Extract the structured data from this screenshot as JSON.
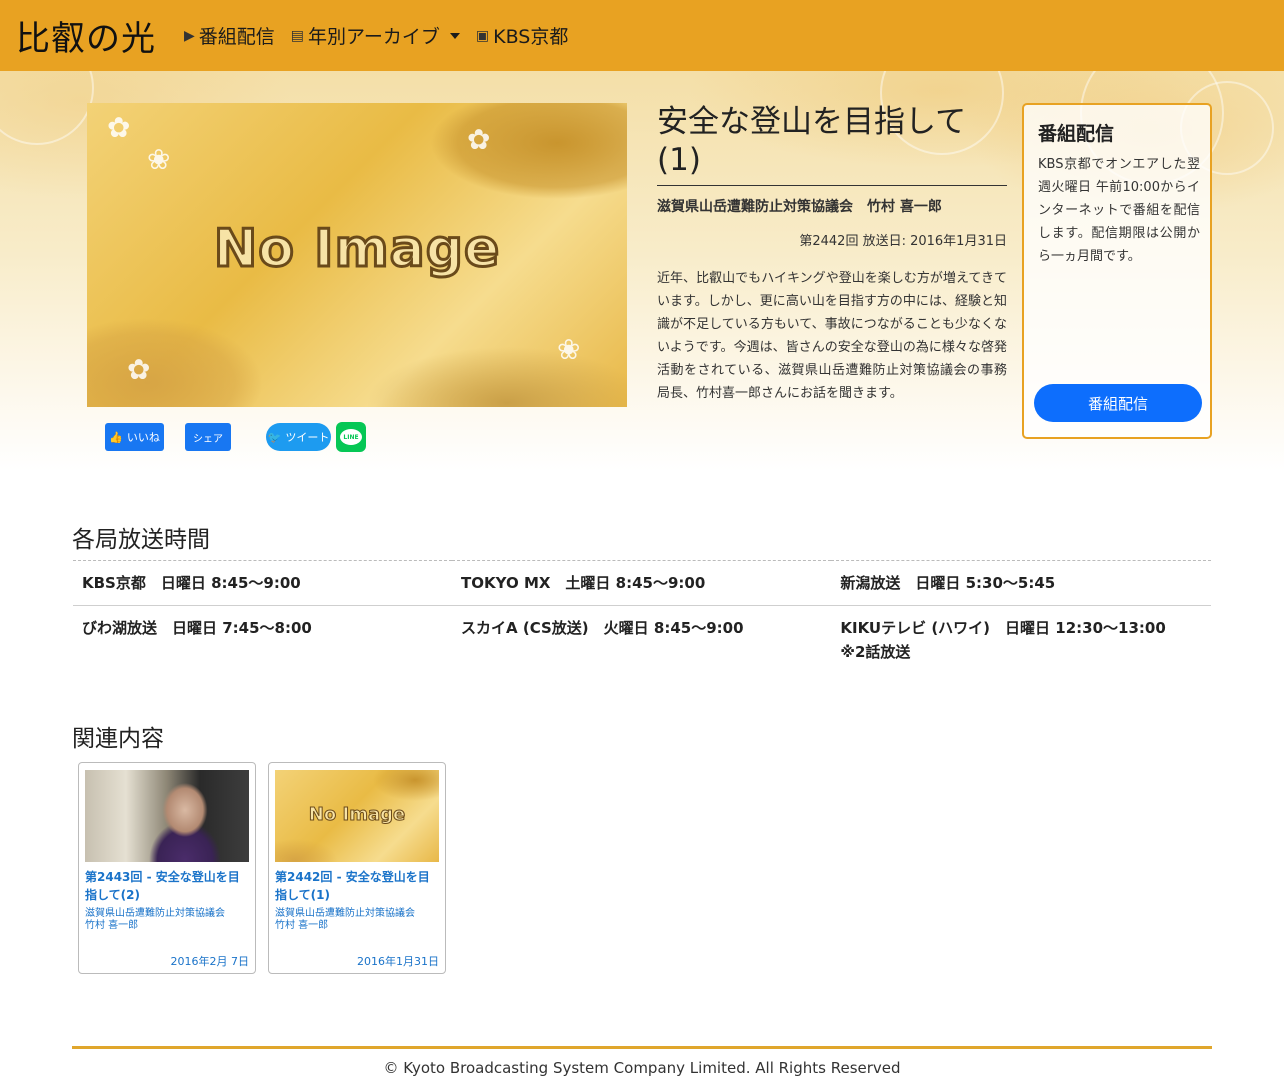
{
  "navbar": {
    "brand": "比叡の光",
    "items": [
      {
        "icon": "video-icon",
        "label": "番組配信"
      },
      {
        "icon": "archive-icon",
        "label": "年別アーカイブ"
      },
      {
        "icon": "tv-icon",
        "label": "KBS京都"
      }
    ],
    "color": "#e8a222"
  },
  "episode": {
    "image_text": "No Image",
    "title": "安全な登山を目指して(1)",
    "organization": "滋賀県山岳遭難防止対策協議会　竹村 喜一郎",
    "meta": "第2442回 放送日: 2016年1月31日",
    "description": "近年、比叡山でもハイキングや登山を楽しむ方が増えてきています。しかし、更に高い山を目指す方の中には、経験と知識が不足している方もいて、事故につながることも少なくないようです。今週は、皆さんの安全な登山の為に様々な啓発活動をされている、滋賀県山岳遭難防止対策協議会の事務局長、竹村喜一郎さんにお話を聞きます。"
  },
  "share": {
    "facebook_like": "いいね",
    "facebook_share": "シェア",
    "twitter": "ツイート",
    "line": "LINE"
  },
  "stream_card": {
    "title": "番組配信",
    "text": "KBS京都でオンエアした翌週火曜日 午前10:00からインターネットで番組を配信します。配信期限は公開から一ヵ月間です。",
    "button": "番組配信",
    "button_color": "#0d6efd"
  },
  "schedule": {
    "heading": "各局放送時間",
    "rows": [
      [
        "KBS京都　日曜日 8:45〜9:00",
        "TOKYO MX　土曜日 8:45〜9:00",
        "新潟放送　日曜日 5:30〜5:45"
      ],
      [
        "びわ湖放送　日曜日 7:45〜8:00",
        "スカイA (CS放送)　火曜日 8:45〜9:00",
        "KIKUテレビ (ハワイ)　日曜日 12:30〜13:00"
      ]
    ],
    "note": "※2話放送"
  },
  "related": {
    "heading": "関連内容",
    "items": [
      {
        "title": "第2443回 - 安全な登山を目指して(2)",
        "org": "滋賀県山岳遭難防止対策協議会",
        "person": "竹村 喜一郎",
        "date": "2016年2月 7日",
        "thumb": "photo"
      },
      {
        "title": "第2442回 - 安全な登山を目指して(1)",
        "org": "滋賀県山岳遭難防止対策協議会",
        "person": "竹村 喜一郎",
        "date": "2016年1月31日",
        "thumb": "No Image"
      }
    ],
    "link_color": "#1a73c9"
  },
  "footer": {
    "copyright": "© Kyoto Broadcasting System Company Limited. All Rights Reserved"
  }
}
